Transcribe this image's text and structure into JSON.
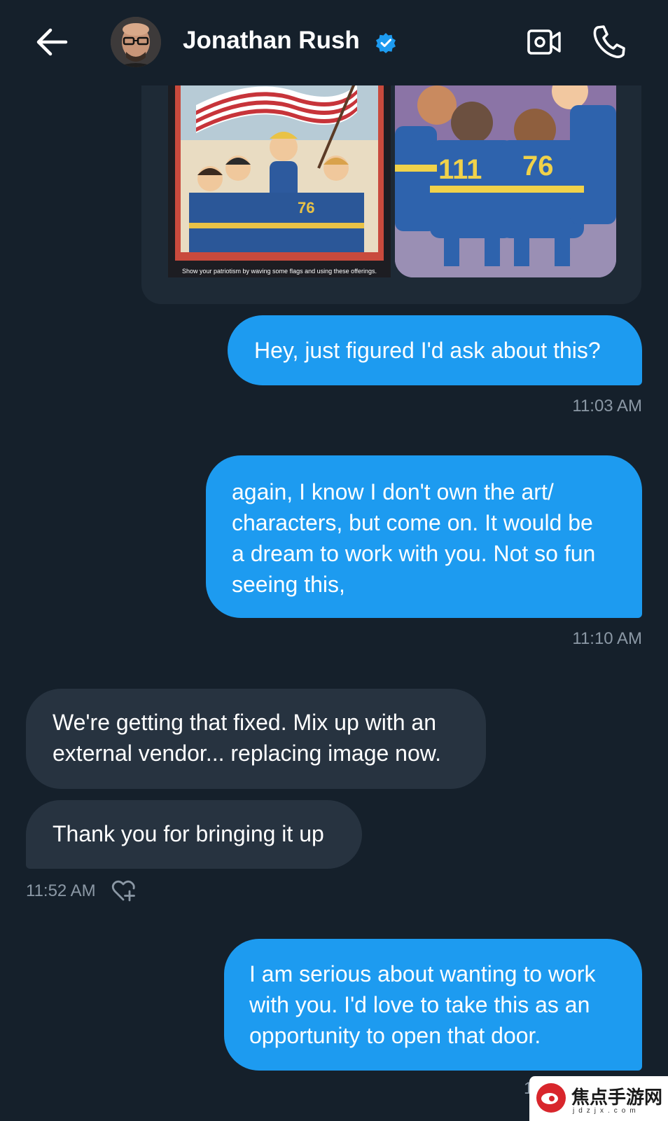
{
  "header": {
    "contact_name": "Jonathan Rush",
    "verified": true
  },
  "attachment": {
    "caption": "Show your patriotism by waving some flags and using these offerings.",
    "image_left_alt": "Vault boy and vault dwellers waving an American flag",
    "image_right_alt": "Vault dwellers in blue jumpsuits numbered 111 and 76"
  },
  "messages": [
    {
      "side": "sent",
      "text": "Hey, just figured I'd ask about this?",
      "time": "11:03 AM"
    },
    {
      "side": "sent",
      "text": "again, I know I don't own the art/\ncharacters, but come on. It would be\na dream to work with you. Not so fun\nseeing this,",
      "time": "11:10 AM"
    },
    {
      "side": "received",
      "text": "We're getting that fixed.  Mix up with an\nexternal vendor... replacing image now."
    },
    {
      "side": "received",
      "text": "Thank you for bringing it up",
      "time": "11:52 AM"
    },
    {
      "side": "sent",
      "text": "I am serious about wanting to work\nwith you. I'd love to take this as an\nopportunity to open that door.",
      "time": "1"
    }
  ],
  "watermark": {
    "title": "焦点手游网",
    "subtitle": "jdzjx.com"
  },
  "colors": {
    "background": "#15202b",
    "sent_bubble": "#1d9bf0",
    "received_bubble": "#273340",
    "timestamp": "#8b98a5",
    "verified": "#1d9bf0"
  }
}
